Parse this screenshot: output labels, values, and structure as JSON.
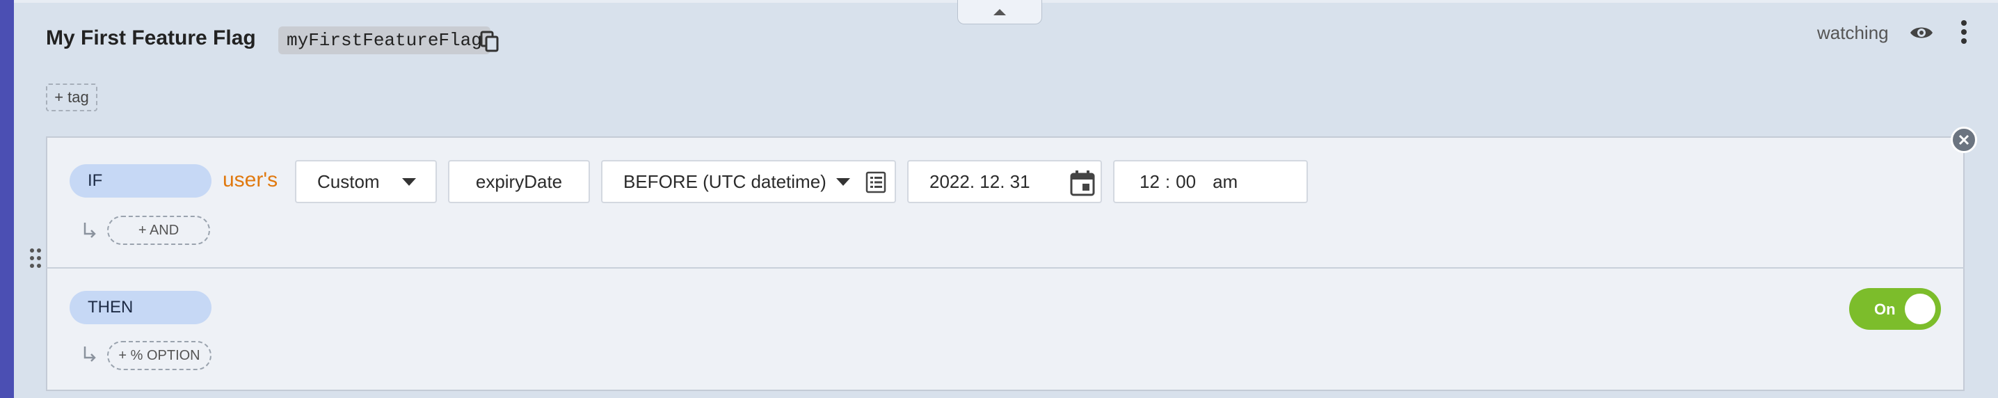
{
  "flag": {
    "name": "My First Feature Flag",
    "key": "myFirstFeatureFlag",
    "watch_status": "watching",
    "add_tag_label": "+ tag"
  },
  "rule": {
    "if_label": "IF",
    "subject_label": "user's",
    "attribute_type": "Custom",
    "attribute_name": "expiryDate",
    "operator": "BEFORE (UTC datetime)",
    "date_value": "2022. 12. 31",
    "time_hour": "12",
    "time_separator": ":",
    "time_minute": "00",
    "time_period": "am",
    "add_and_label": "+ AND",
    "then_label": "THEN",
    "add_option_label": "+ % OPTION",
    "value_toggle_label": "On",
    "value_toggle_state": true
  },
  "colors": {
    "accent_bar": "#4b4fb3",
    "toggle_on": "#7cbd2b",
    "pill_bg": "#c6d8f5",
    "subject_text": "#e0790f"
  },
  "icons": [
    "copy-icon",
    "eye-icon",
    "more-vertical-icon",
    "close-icon",
    "drag-handle-icon",
    "chevron-up-icon",
    "list-icon",
    "calendar-icon",
    "return-arrow-icon"
  ]
}
